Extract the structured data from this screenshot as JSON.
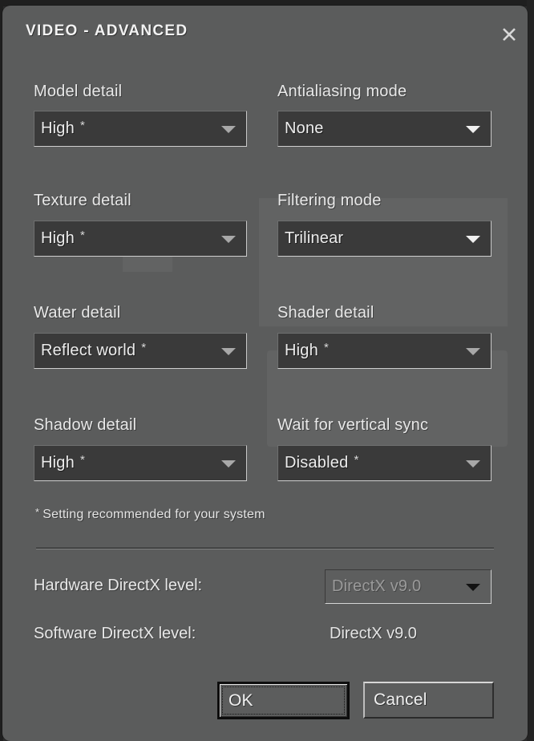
{
  "window": {
    "title": "VIDEO - ADVANCED",
    "close_icon": "close-x-icon"
  },
  "settings": [
    {
      "id": "model-detail",
      "label": "Model detail",
      "value": "High",
      "recommended": true,
      "column": "left",
      "row": 1
    },
    {
      "id": "antialiasing-mode",
      "label": "Antialiasing mode",
      "value": "None",
      "recommended": false,
      "column": "right",
      "row": 1
    },
    {
      "id": "texture-detail",
      "label": "Texture detail",
      "value": "High",
      "recommended": true,
      "column": "left",
      "row": 2
    },
    {
      "id": "filtering-mode",
      "label": "Filtering mode",
      "value": "Trilinear",
      "recommended": false,
      "column": "right",
      "row": 2
    },
    {
      "id": "water-detail",
      "label": "Water detail",
      "value": "Reflect world",
      "recommended": true,
      "column": "left",
      "row": 3
    },
    {
      "id": "shader-detail",
      "label": "Shader detail",
      "value": "High",
      "recommended": true,
      "column": "right",
      "row": 3
    },
    {
      "id": "shadow-detail",
      "label": "Shadow detail",
      "value": "High",
      "recommended": true,
      "column": "left",
      "row": 4
    },
    {
      "id": "wait-for-vertical-sync",
      "label": "Wait for vertical sync",
      "value": "Disabled",
      "recommended": true,
      "column": "right",
      "row": 4
    }
  ],
  "footnote": {
    "star": "*",
    "text": "Setting recommended for your system"
  },
  "directx": {
    "hardware_label": "Hardware DirectX level:",
    "hardware_value": "DirectX v9.0",
    "software_label": "Software DirectX level:",
    "software_value": "DirectX v9.0"
  },
  "buttons": {
    "ok": "OK",
    "cancel": "Cancel"
  },
  "colors": {
    "dialog_background": "#5b5c5c",
    "combo_background": "#3a3a3a",
    "text": "#e8e8e8",
    "backdrop": "#1f1f1f"
  },
  "star_glyph": "*"
}
